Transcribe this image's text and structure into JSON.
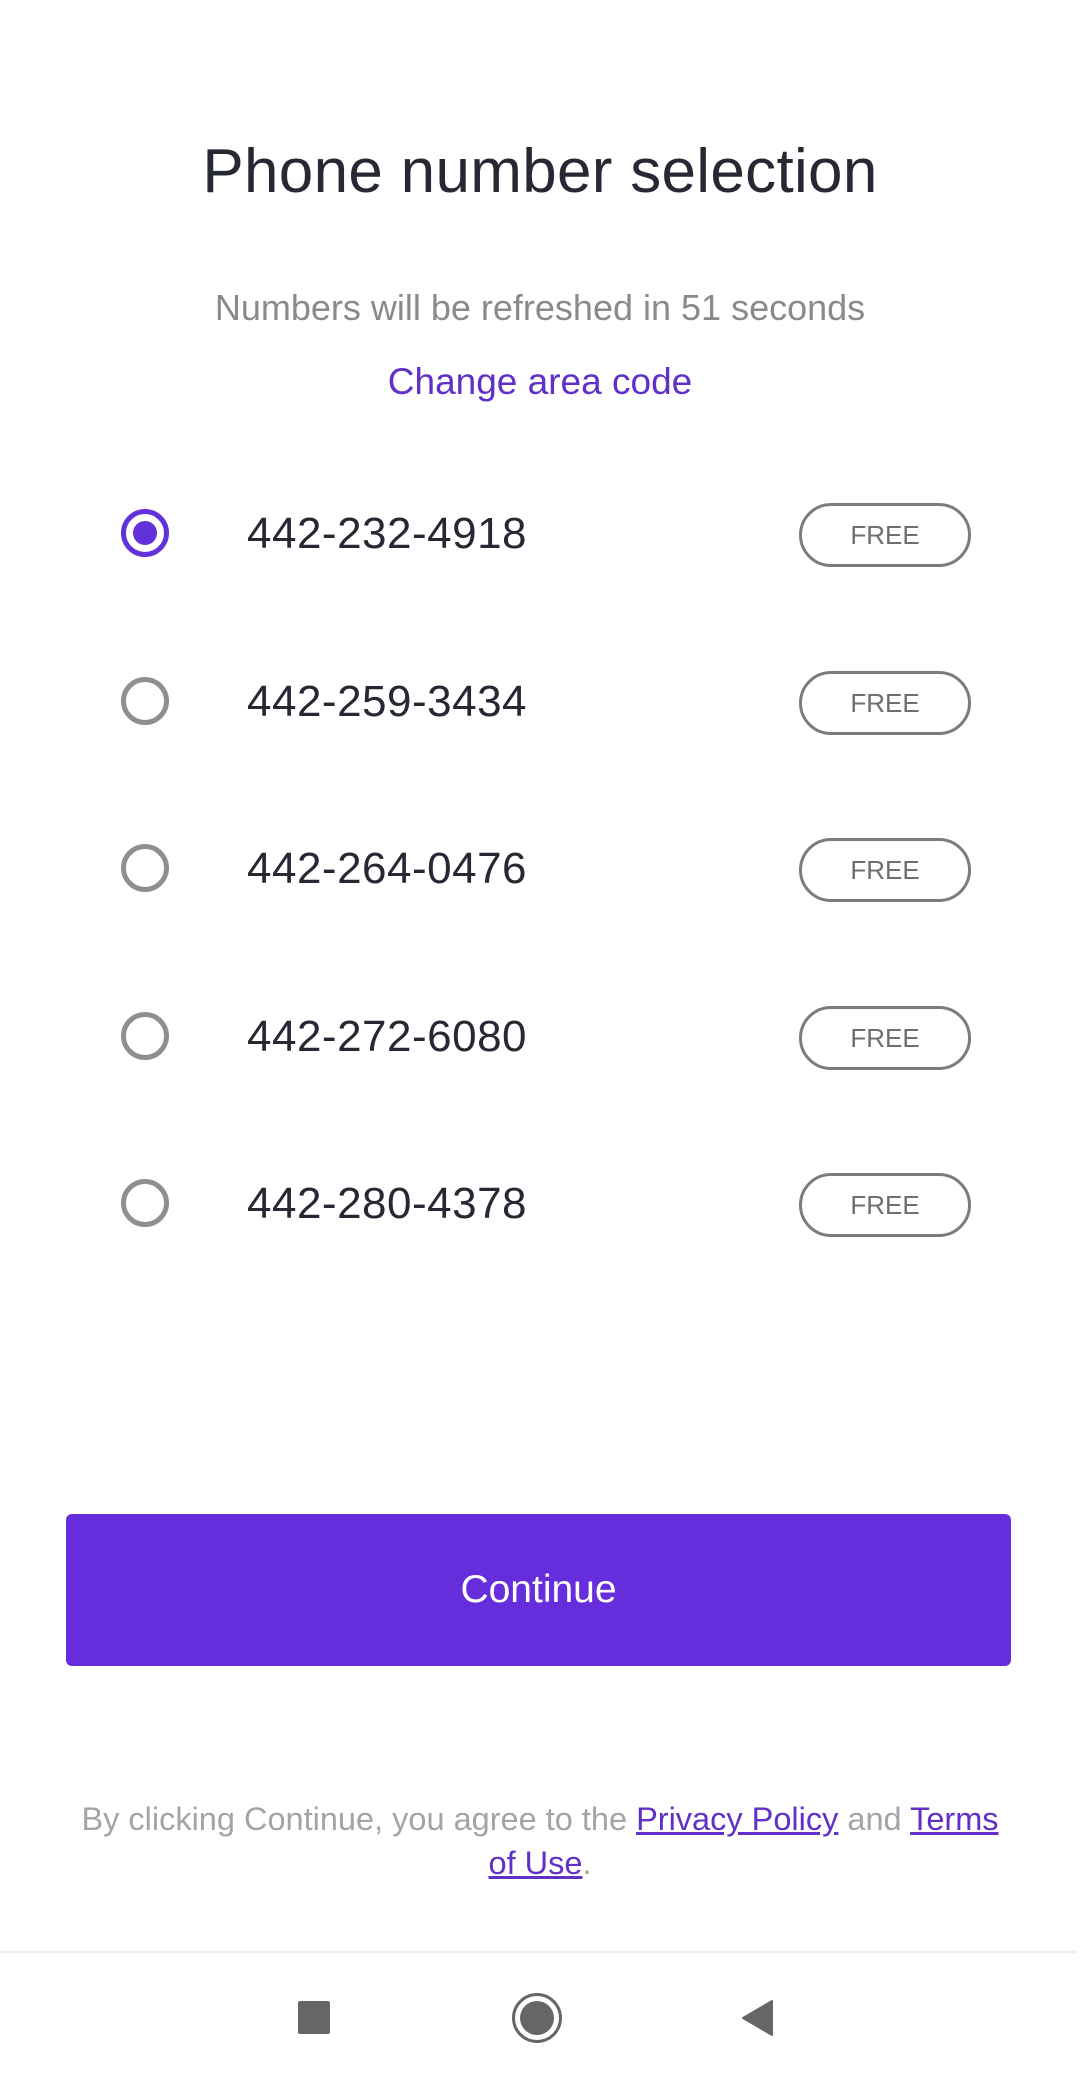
{
  "header": {
    "title": "Phone number selection",
    "refresh_notice": "Numbers will be refreshed in 51 seconds",
    "change_area_code_label": "Change area code"
  },
  "numbers": [
    {
      "phone": "442-232-4918",
      "badge": "FREE",
      "selected": true
    },
    {
      "phone": "442-259-3434",
      "badge": "FREE",
      "selected": false
    },
    {
      "phone": "442-264-0476",
      "badge": "FREE",
      "selected": false
    },
    {
      "phone": "442-272-6080",
      "badge": "FREE",
      "selected": false
    },
    {
      "phone": "442-280-4378",
      "badge": "FREE",
      "selected": false
    }
  ],
  "actions": {
    "continue_label": "Continue"
  },
  "legal": {
    "prefix": "By clicking Continue, you agree to the ",
    "privacy_label": "Privacy Policy",
    "conjunction": " and ",
    "terms_label": "Terms of Use",
    "suffix": "."
  },
  "navbar": {
    "recents_icon": "square-icon",
    "home_icon": "circle-icon",
    "back_icon": "triangle-back-icon"
  },
  "colors": {
    "accent": "#652ddb",
    "link": "#6030c9",
    "text_primary": "#262833",
    "text_secondary": "#8a8a8e"
  }
}
